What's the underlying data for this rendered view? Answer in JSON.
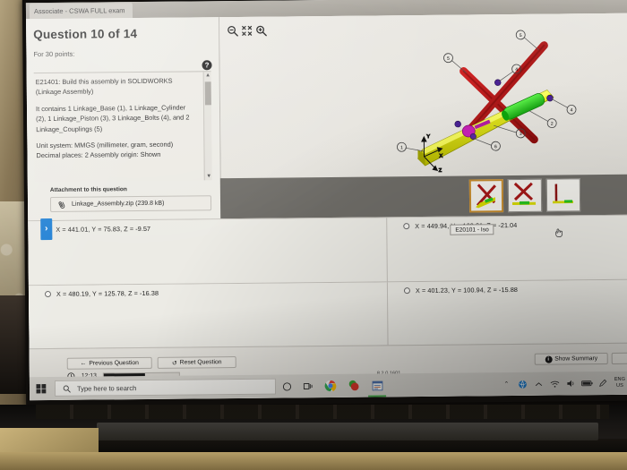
{
  "window": {
    "tab_title": "Associate - CSWA FULL exam"
  },
  "question": {
    "heading": "Question 10 of 14",
    "points_label": "For 30 points:",
    "help_icon": "?",
    "body_paragraphs": [
      "E21401:  Build this assembly in SOLIDWORKS (Linkage Assembly)",
      "It contains 1 Linkage_Base (1), 1 Linkage_Cylinder (2), 1 Linkage_Piston (3), 3 Linkage_Bolts (4), and 2 Linkage_Couplings (5)",
      "Unit system: MMGS (millimeter, gram, second) Decimal places: 2 Assembly origin: Shown"
    ],
    "attachment_label": "Attachment to this question",
    "attachment_file": "Linkage_Assembly.zip (239.8 kB)",
    "scroll_up": "▲",
    "scroll_down": "▼",
    "expand_tab_glyph": "›"
  },
  "viewer": {
    "zoom_out_icon": "zoom-out-icon",
    "zoom_fit_icon": "zoom-fit-icon",
    "zoom_in_icon": "zoom-in-icon",
    "axis_labels": {
      "x": "X",
      "y": "Y",
      "z": "Z"
    },
    "balloons": [
      "1",
      "2",
      "3",
      "4",
      "4",
      "5",
      "5",
      "6"
    ],
    "thumbnails": [
      {
        "name": "view-iso-selected",
        "selected": true
      },
      {
        "name": "view-front",
        "selected": false
      },
      {
        "name": "view-side",
        "selected": false
      }
    ],
    "colors": {
      "base": "#d6d900",
      "cylinder": "#27c31f",
      "piston": "#b0209b",
      "linkage": "#aa1414",
      "bolt": "#5a2aa0"
    }
  },
  "answers": [
    {
      "id": "a",
      "text": "X = 441.01, Y = 75.83, Z = -9.57",
      "selected": false
    },
    {
      "id": "b",
      "text": "X = 449.94, Y = 162.21, Z = -21.04",
      "selected": false
    },
    {
      "id": "c",
      "text": "X = 480.19, Y = 125.78, Z = -16.38",
      "selected": false
    },
    {
      "id": "d",
      "text": "X = 401.23, Y = 100.94, Z = -15.88",
      "selected": false
    }
  ],
  "tooltip": {
    "text": "E20101 - Iso"
  },
  "footer": {
    "previous_label": "Previous Question",
    "previous_icon": "←",
    "reset_label": "Reset Question",
    "reset_icon": "↺",
    "summary_label": "Show Summary",
    "summary_icon": "i",
    "timer_value": "12:13",
    "timer_icon": "clock-icon",
    "version": "8.2.0.1601"
  },
  "taskbar": {
    "start_icon": "windows-icon",
    "search_placeholder": "Type here to search",
    "search_icon": "search-icon",
    "cortana_icon": "cortana-circle-icon",
    "taskview_icon": "task-view-icon",
    "apps": [
      {
        "name": "chrome-icon"
      },
      {
        "name": "app-red-green-icon"
      },
      {
        "name": "exam-app-icon",
        "active": true
      }
    ],
    "tray": {
      "overflow_icon": "⌃",
      "security_icon": "shield-globe-icon",
      "network_icon": "wifi-icon",
      "volume_icon": "speaker-icon",
      "battery_icon": "battery-icon",
      "pen_icon": "pen-icon",
      "lang_line1": "ENG",
      "lang_line2": "US"
    }
  }
}
